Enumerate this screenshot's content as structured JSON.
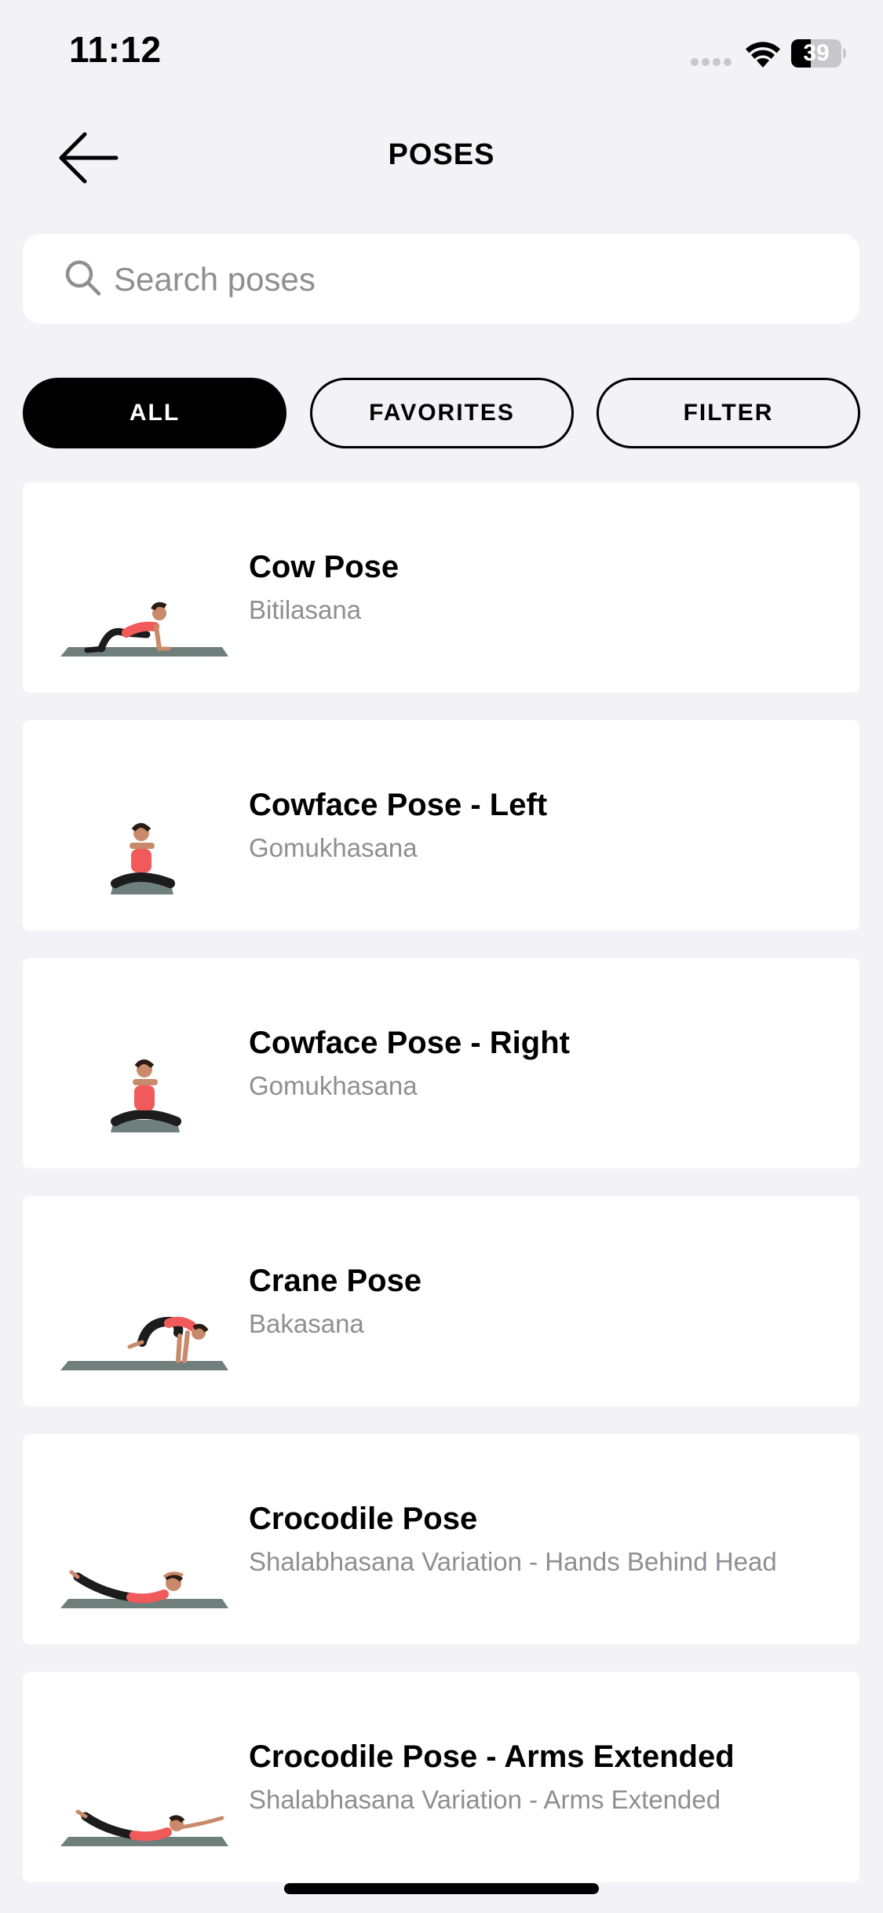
{
  "status_bar": {
    "time": "11:12",
    "battery_level": "39",
    "battery_fraction": 0.39
  },
  "header": {
    "title": "POSES",
    "back_icon": "arrow-left-icon"
  },
  "search": {
    "placeholder": "Search poses",
    "value": "",
    "icon": "search-icon"
  },
  "tabs": [
    {
      "label": "ALL",
      "active": true
    },
    {
      "label": "FAVORITES",
      "active": false
    },
    {
      "label": "FILTER",
      "active": false
    }
  ],
  "poses": [
    {
      "name": "Cow Pose",
      "sanskrit": "Bitilasana"
    },
    {
      "name": "Cowface Pose - Left",
      "sanskrit": "Gomukhasana"
    },
    {
      "name": "Cowface Pose - Right",
      "sanskrit": "Gomukhasana"
    },
    {
      "name": "Crane Pose",
      "sanskrit": "Bakasana"
    },
    {
      "name": "Crocodile Pose",
      "sanskrit": "Shalabhasana Variation - Hands Behind Head"
    },
    {
      "name": "Crocodile Pose - Arms Extended",
      "sanskrit": "Shalabhasana Variation - Arms Extended"
    }
  ],
  "colors": {
    "background": "#f2f2f7",
    "card": "#ffffff",
    "secondary_text": "#8e8e93",
    "mat": "#6f7f7c",
    "top_accent": "#f15a5a",
    "pants": "#1c1c1c",
    "skin": "#c98a6b"
  }
}
